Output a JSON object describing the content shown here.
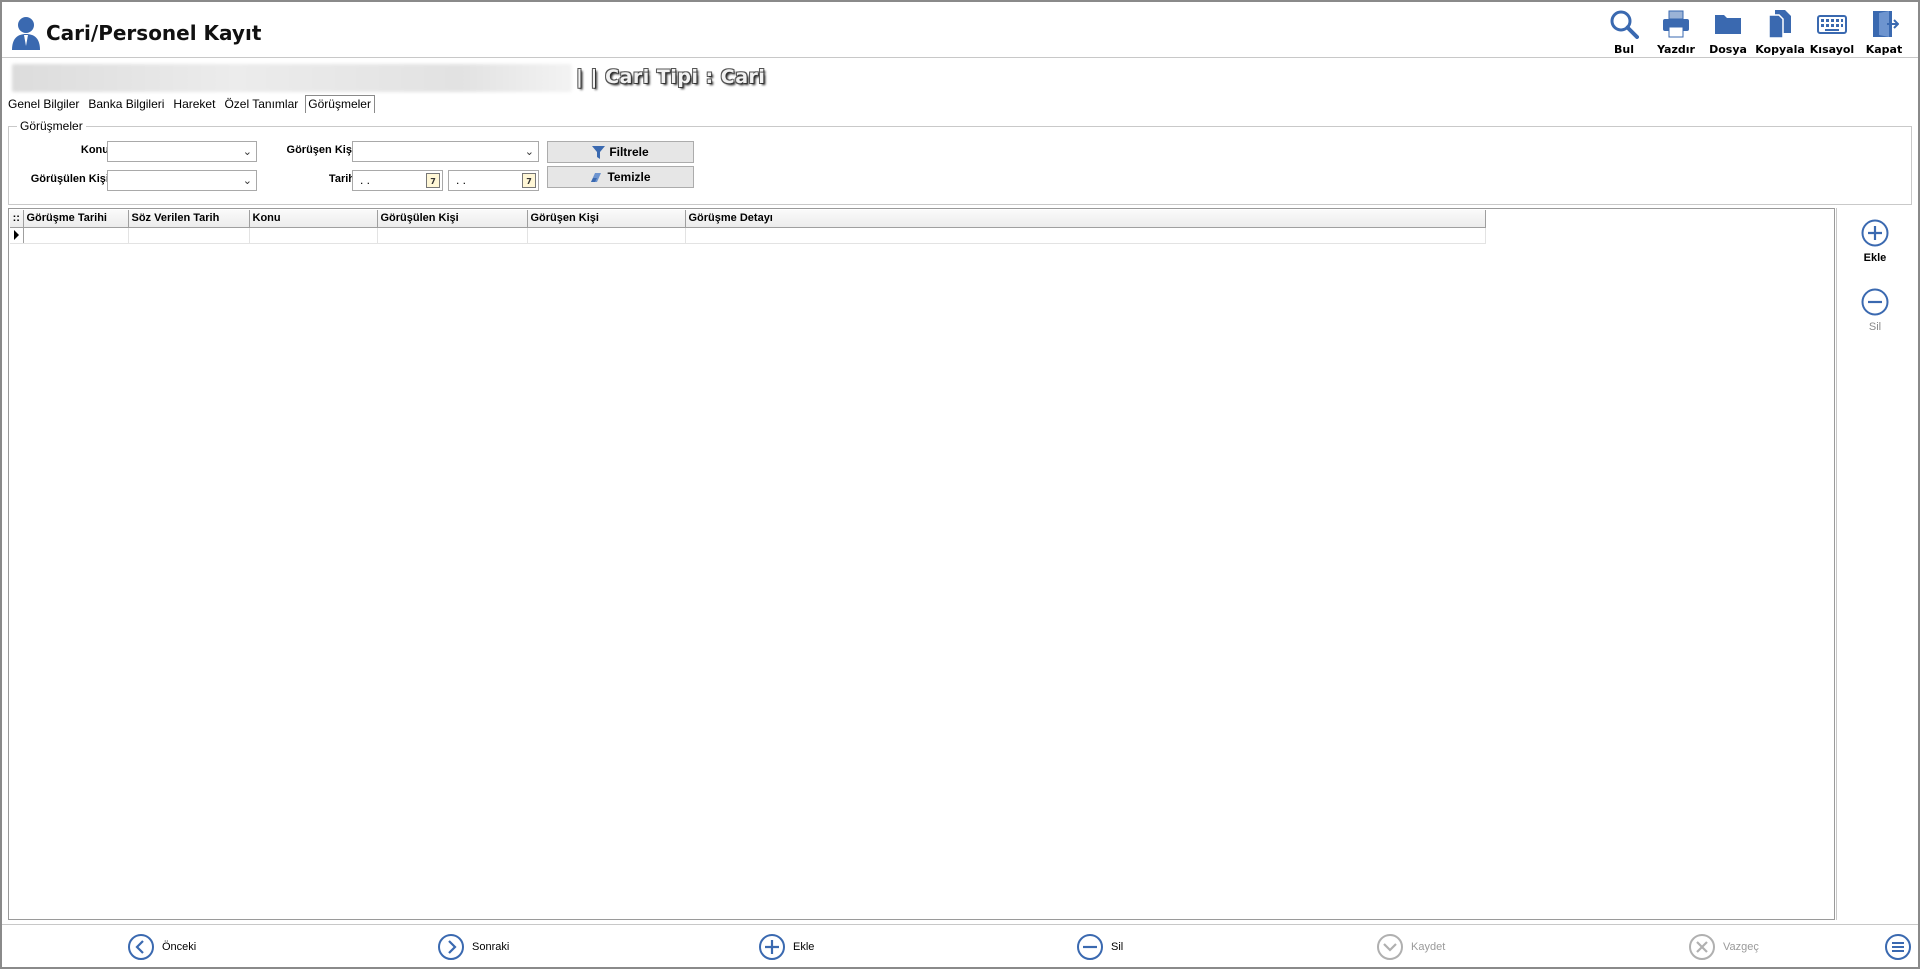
{
  "window": {
    "title": "Cari/Personel Kayıt"
  },
  "toolbar": {
    "find_label": "Bul",
    "print_label": "Yazdır",
    "file_label": "Dosya",
    "copy_label": "Kopyala",
    "shortcut_label": "Kısayol",
    "close_label": "Kapat"
  },
  "record": {
    "type_label": "| | Cari Tipi : Cari"
  },
  "tabs": [
    {
      "label": "Genel Bilgiler",
      "active": false
    },
    {
      "label": "Banka Bilgileri",
      "active": false
    },
    {
      "label": "Hareket",
      "active": false
    },
    {
      "label": "Özel Tanımlar",
      "active": false
    },
    {
      "label": "Görüşmeler",
      "active": true
    }
  ],
  "filter": {
    "group_title": "Görüşmeler",
    "topic_label": "Konu",
    "topic_value": "",
    "contacted_person_label": "Görüşülen Kişi",
    "contacted_person_value": "",
    "meeting_person_label": "Görüşen Kişi",
    "meeting_person_value": "",
    "date_label": "Tarih",
    "date_from": ". .",
    "date_to": ". .",
    "calendar_glyph": "7",
    "filter_button": "Filtrele",
    "clear_button": "Temizle"
  },
  "grid": {
    "columns": [
      "Görüşme Tarihi",
      "Söz Verilen Tarih",
      "Konu",
      "Görüşülen Kişi",
      "Görüşen Kişi",
      "Görüşme Detayı"
    ],
    "rows": [
      [
        "",
        "",
        "",
        "",
        "",
        ""
      ]
    ]
  },
  "side": {
    "add_label": "Ekle",
    "delete_label": "Sil"
  },
  "bottom": {
    "prev_label": "Önceki",
    "next_label": "Sonraki",
    "add_label": "Ekle",
    "delete_label": "Sil",
    "save_label": "Kaydet",
    "cancel_label": "Vazgeç"
  },
  "colors": {
    "accent": "#3a69b0",
    "disabled": "#a0a0a0"
  }
}
